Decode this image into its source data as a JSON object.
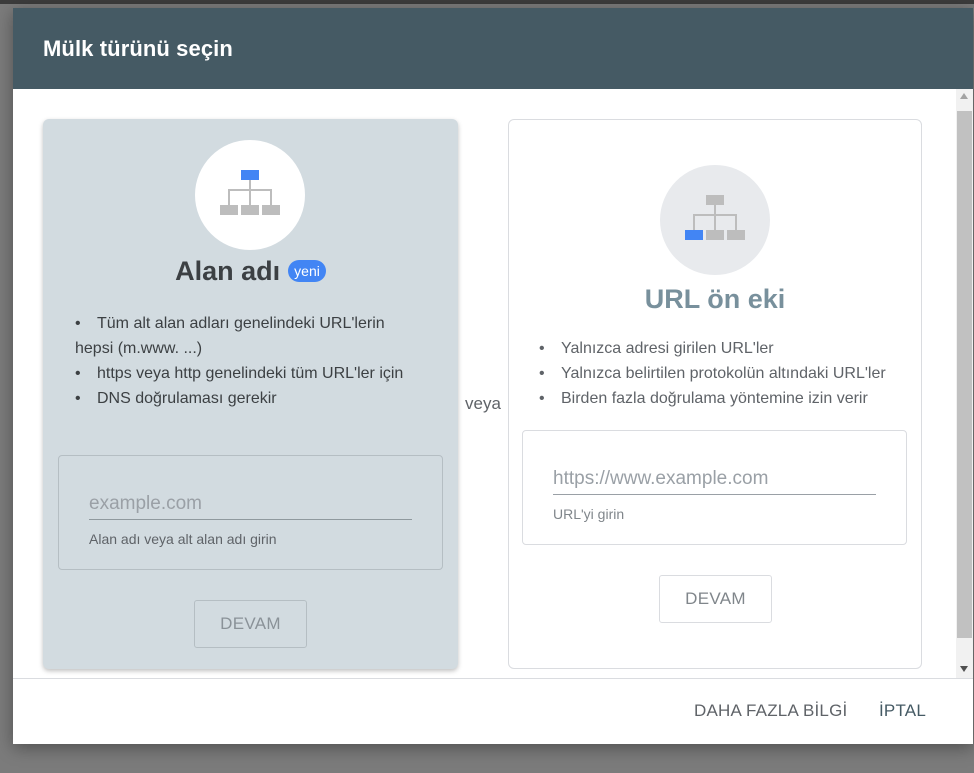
{
  "dialog": {
    "title": "Mülk türünü seçin"
  },
  "domain_card": {
    "title": "Alan adı",
    "badge": "yeni",
    "bullets": [
      "Tüm alt alan adları genelindeki URL'lerin hepsi (m.www. ...)",
      "https veya http genelindeki tüm URL'ler için",
      "DNS doğrulaması gerekir"
    ],
    "input_placeholder": "example.com",
    "input_value": "",
    "helper": "Alan adı veya alt alan adı girin",
    "button_label": "DEVAM",
    "icon": "sitemap-icon-top-highlight"
  },
  "separator": "veya",
  "url_card": {
    "title": "URL ön eki",
    "bullets": [
      "Yalnızca adresi girilen URL'ler",
      "Yalnızca belirtilen protokolün altındaki URL'ler",
      "Birden fazla doğrulama yöntemine izin verir"
    ],
    "input_placeholder": "https://www.example.com",
    "input_value": "",
    "helper": "URL'yi girin",
    "button_label": "DEVAM",
    "icon": "sitemap-icon-leaf-highlight"
  },
  "footer": {
    "more_info_label": "DAHA FAZLA BİLGİ",
    "cancel_label": "İPTAL"
  },
  "colors": {
    "header": "#455a64",
    "accent": "#4285f4",
    "selected_card": "#d2dbe0"
  }
}
